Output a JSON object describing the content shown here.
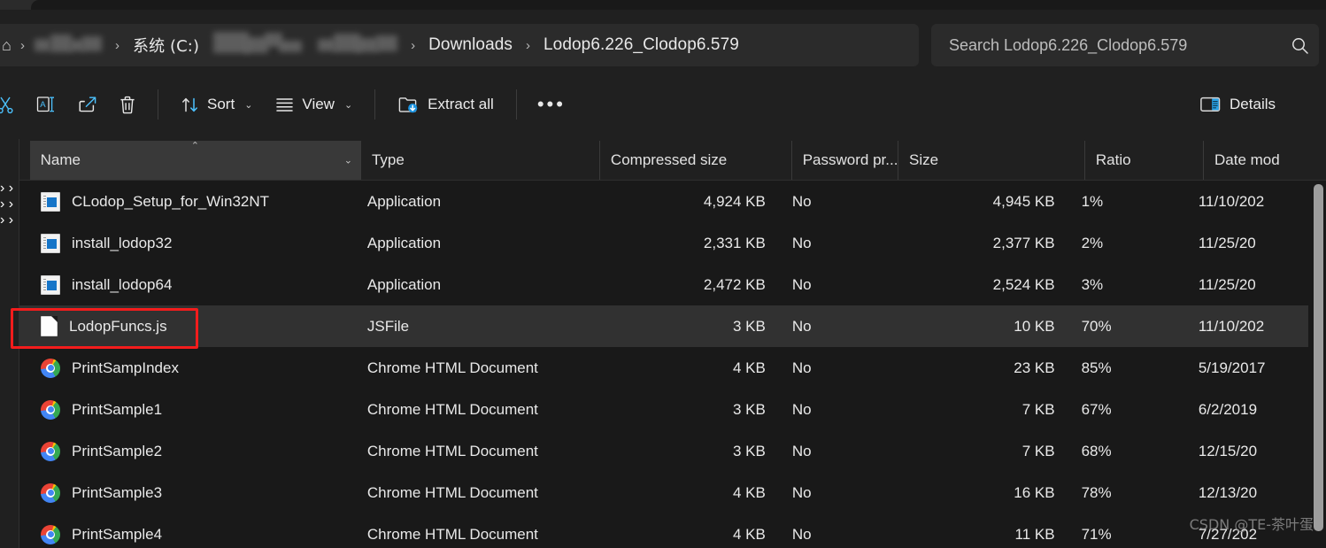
{
  "window": {
    "tab_strip_visible": true
  },
  "address_bar": {
    "home_icon": "home-icon",
    "separator": "›",
    "crumbs": [
      {
        "label": "",
        "redacted": true
      },
      {
        "label": "系统 (C:)",
        "redacted": false
      },
      {
        "label": "",
        "redacted": true
      },
      {
        "label": "",
        "redacted": true
      },
      {
        "label": "Downloads",
        "redacted": false
      },
      {
        "label": "Lodop6.226_Clodop6.579",
        "redacted": false
      }
    ]
  },
  "search": {
    "placeholder": "Search Lodop6.226_Clodop6.579",
    "icon": "search-icon",
    "value": ""
  },
  "toolbar": {
    "cut_label": "",
    "rename_label": "",
    "share_label": "",
    "delete_label": "",
    "sort_label": "Sort",
    "view_label": "View",
    "extract_all_label": "Extract all",
    "more_label": "•••",
    "details_label": "Details",
    "caret": "⌄",
    "icons": {
      "cut": "scissors-icon",
      "rename": "rename-icon",
      "share": "share-icon",
      "delete": "trash-icon",
      "sort": "sort-arrows-icon",
      "view": "view-list-icon",
      "extract": "extract-folder-icon",
      "more": "ellipsis-icon",
      "details": "details-pane-icon"
    }
  },
  "columns": [
    {
      "key": "name",
      "label": "Name",
      "sorted": true,
      "sort_direction": "ascending"
    },
    {
      "key": "type",
      "label": "Type",
      "sorted": false,
      "sort_direction": ""
    },
    {
      "key": "csize",
      "label": "Compressed size",
      "sorted": false,
      "sort_direction": ""
    },
    {
      "key": "pwd",
      "label": "Password pr...",
      "sorted": false,
      "sort_direction": ""
    },
    {
      "key": "size",
      "label": "Size",
      "sorted": false,
      "sort_direction": ""
    },
    {
      "key": "ratio",
      "label": "Ratio",
      "sorted": false,
      "sort_direction": ""
    },
    {
      "key": "date",
      "label": "Date mod",
      "sorted": false,
      "sort_direction": ""
    }
  ],
  "sort_indicator": {
    "ascending_glyph": "︿",
    "dropdown_glyph": "⌄"
  },
  "files": [
    {
      "name": "CLodop_Setup_for_Win32NT",
      "icon": "application-icon",
      "type": "Application",
      "compressed_size": "4,924 KB",
      "password_protected": "No",
      "size": "4,945 KB",
      "ratio": "1%",
      "date_modified": "11/10/202",
      "selected": false
    },
    {
      "name": "install_lodop32",
      "icon": "application-icon",
      "type": "Application",
      "compressed_size": "2,331 KB",
      "password_protected": "No",
      "size": "2,377 KB",
      "ratio": "2%",
      "date_modified": "11/25/20",
      "selected": false
    },
    {
      "name": "install_lodop64",
      "icon": "application-icon",
      "type": "Application",
      "compressed_size": "2,472 KB",
      "password_protected": "No",
      "size": "2,524 KB",
      "ratio": "3%",
      "date_modified": "11/25/20",
      "selected": false
    },
    {
      "name": "LodopFuncs.js",
      "icon": "js-file-icon",
      "type": "JSFile",
      "compressed_size": "3 KB",
      "password_protected": "No",
      "size": "10 KB",
      "ratio": "70%",
      "date_modified": "11/10/202",
      "selected": true
    },
    {
      "name": "PrintSampIndex",
      "icon": "chrome-icon",
      "type": "Chrome HTML Document",
      "compressed_size": "4 KB",
      "password_protected": "No",
      "size": "23 KB",
      "ratio": "85%",
      "date_modified": "5/19/2017",
      "selected": false
    },
    {
      "name": "PrintSample1",
      "icon": "chrome-icon",
      "type": "Chrome HTML Document",
      "compressed_size": "3 KB",
      "password_protected": "No",
      "size": "7 KB",
      "ratio": "67%",
      "date_modified": "6/2/2019",
      "selected": false
    },
    {
      "name": "PrintSample2",
      "icon": "chrome-icon",
      "type": "Chrome HTML Document",
      "compressed_size": "3 KB",
      "password_protected": "No",
      "size": "7 KB",
      "ratio": "68%",
      "date_modified": "12/15/20",
      "selected": false
    },
    {
      "name": "PrintSample3",
      "icon": "chrome-icon",
      "type": "Chrome HTML Document",
      "compressed_size": "4 KB",
      "password_protected": "No",
      "size": "16 KB",
      "ratio": "78%",
      "date_modified": "12/13/20",
      "selected": false
    },
    {
      "name": "PrintSample4",
      "icon": "chrome-icon",
      "type": "Chrome HTML Document",
      "compressed_size": "4 KB",
      "password_protected": "No",
      "size": "11 KB",
      "ratio": "71%",
      "date_modified": "7/27/202",
      "selected": false
    }
  ],
  "annotation": {
    "shape": "rectangle",
    "color": "#f31c1c",
    "targets": "LodopFuncs.js"
  },
  "watermark": {
    "text": "CSDN @TE-茶叶蛋"
  },
  "colors": {
    "background": "#191919",
    "chrome_background": "#202020",
    "field_background": "#2b2b2b",
    "selected_row": "#313131",
    "sorted_header": "#393939",
    "accent": "#4cc2ff",
    "annotation_red": "#f31c1c"
  }
}
